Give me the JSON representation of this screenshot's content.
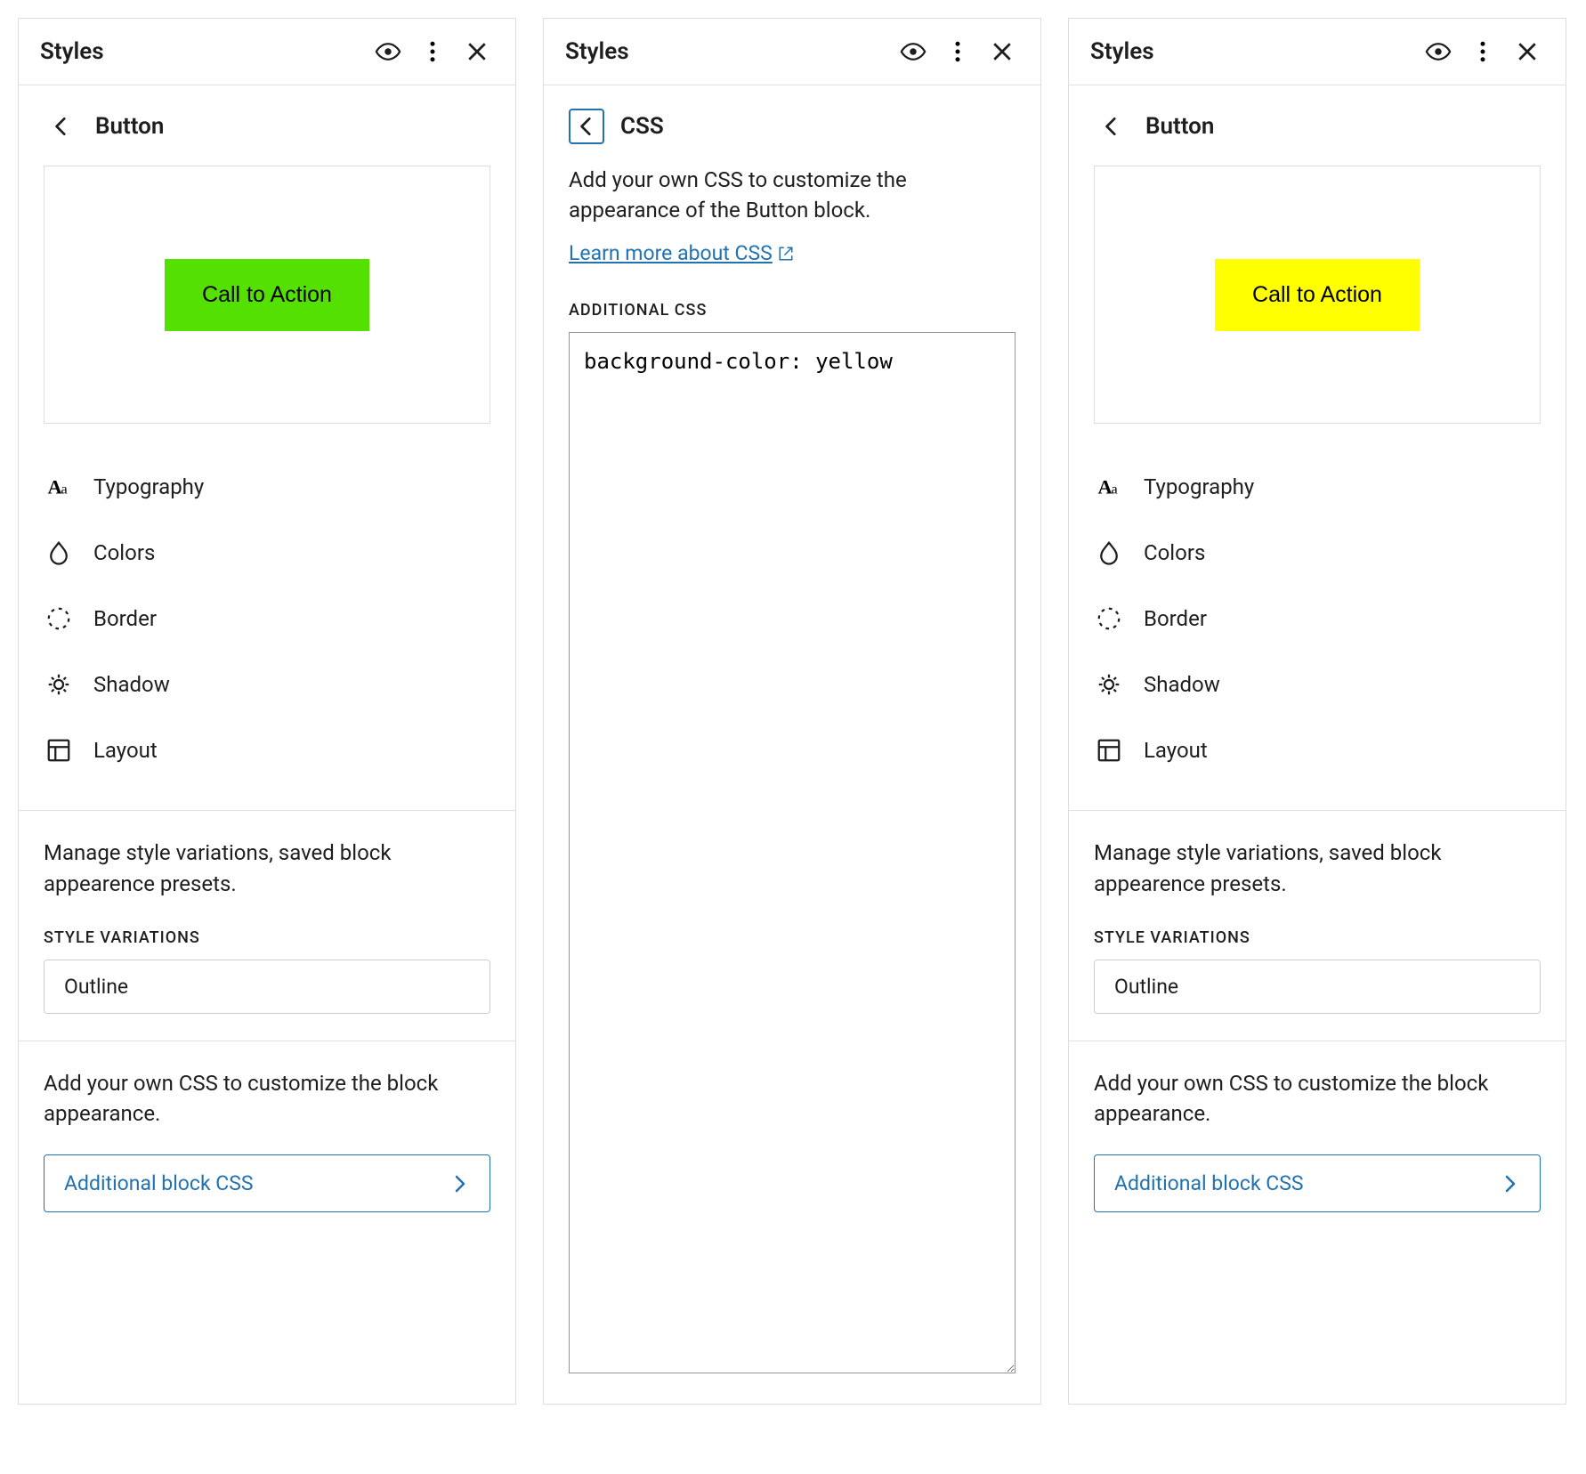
{
  "header": {
    "title": "Styles"
  },
  "panelA": {
    "subtitle": "Button",
    "cta_label": "Call to Action",
    "cta_bg": "#54e000",
    "menu": {
      "typography": "Typography",
      "colors": "Colors",
      "border": "Border",
      "shadow": "Shadow",
      "layout": "Layout"
    },
    "variations_desc": "Manage style variations, saved block appearence presets.",
    "variations_label": "STYLE VARIATIONS",
    "variation_item": "Outline",
    "css_desc": "Add your own CSS to customize the block appearance.",
    "css_button": "Additional block CSS"
  },
  "panelB": {
    "subtitle": "CSS",
    "desc": "Add your own CSS to customize the appearance of the Button block.",
    "learn_link": "Learn more about CSS",
    "css_label": "ADDITIONAL CSS",
    "css_value": "background-color: yellow"
  },
  "panelC": {
    "subtitle": "Button",
    "cta_label": "Call to Action",
    "cta_bg": "#ffff00",
    "menu": {
      "typography": "Typography",
      "colors": "Colors",
      "border": "Border",
      "shadow": "Shadow",
      "layout": "Layout"
    },
    "variations_desc": "Manage style variations, saved block appearence presets.",
    "variations_label": "STYLE VARIATIONS",
    "variation_item": "Outline",
    "css_desc": "Add your own CSS to customize the block appearance.",
    "css_button": "Additional block CSS"
  }
}
